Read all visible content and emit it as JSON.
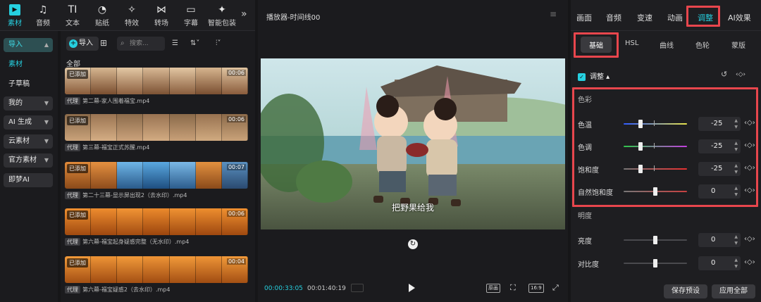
{
  "toolbar": {
    "items": [
      {
        "label": "素材",
        "icon": "media-icon",
        "active": true
      },
      {
        "label": "音频",
        "icon": "audio-icon"
      },
      {
        "label": "文本",
        "icon": "text-icon"
      },
      {
        "label": "贴纸",
        "icon": "sticker-icon"
      },
      {
        "label": "特效",
        "icon": "effects-icon"
      },
      {
        "label": "转场",
        "icon": "transition-icon"
      },
      {
        "label": "字幕",
        "icon": "subtitle-icon"
      },
      {
        "label": "智能包装",
        "icon": "smart-pack-icon"
      }
    ],
    "more": "»"
  },
  "sidenav": {
    "items": [
      {
        "label": "导入"
      },
      {
        "label": "素材"
      },
      {
        "label": "子草稿"
      },
      {
        "label": "我的"
      },
      {
        "label": "AI 生成"
      },
      {
        "label": "云素材"
      },
      {
        "label": "官方素材"
      },
      {
        "label": "即梦AI"
      }
    ]
  },
  "media": {
    "import_label": "导入",
    "search_placeholder": "搜索...",
    "all_label": "全部",
    "clips": [
      {
        "badge": "已添加",
        "duration": "00:06",
        "tag": "代理",
        "name": "第二幕-家人围着福宝.mp4"
      },
      {
        "badge": "已添加",
        "duration": "00:06",
        "tag": "代理",
        "name": "第三幕-福宝正式苏醒.mp4"
      },
      {
        "badge": "已添加",
        "duration": "00:07",
        "tag": "代理",
        "name": "第二十三幕-显示屏出现2（去水印）.mp4"
      },
      {
        "badge": "已添加",
        "duration": "00:06",
        "tag": "代理",
        "name": "第六幕-福宝起身疑惑完整（无水印）.mp4"
      },
      {
        "badge": "已添加",
        "duration": "00:04",
        "tag": "代理",
        "name": "第六幕-福宝疑惑2（去水印）.mp4"
      }
    ]
  },
  "player": {
    "title": "播放器-时间线00",
    "subtitle": "把野果给我",
    "time_current": "00:00:33:05",
    "time_total": "00:01:40:19",
    "btn_original": "原画",
    "btn_ratio": "16:9"
  },
  "right": {
    "tabs": [
      "画面",
      "音频",
      "变速",
      "动画",
      "调整",
      "AI效果"
    ],
    "active_tab": "调整",
    "subtabs": [
      "基础",
      "HSL",
      "曲线",
      "色轮",
      "蒙版"
    ],
    "active_subtab": "基础",
    "section_label": "调整",
    "group_color": "色彩",
    "group_light": "明度",
    "color_rows": [
      {
        "label": "色温",
        "value": "-25",
        "knob_pct": 0.27,
        "gradient": "linear-gradient(90deg,#2f5bff,#e8e34a)"
      },
      {
        "label": "色调",
        "value": "-25",
        "knob_pct": 0.27,
        "gradient": "linear-gradient(90deg,#2fc64a,#c43ee0)"
      },
      {
        "label": "饱和度",
        "value": "-25",
        "knob_pct": 0.27,
        "gradient": "linear-gradient(90deg,#777,#e83030)"
      },
      {
        "label": "自然饱和度",
        "value": "0",
        "knob_pct": 0.5,
        "gradient": "linear-gradient(90deg,#777,#c84040)"
      }
    ],
    "light_rows": [
      {
        "label": "亮度",
        "value": "0",
        "knob_pct": 0.5,
        "gradient": "linear-gradient(90deg,#444,#555)"
      },
      {
        "label": "对比度",
        "value": "0",
        "knob_pct": 0.5,
        "gradient": "linear-gradient(90deg,#444,#555)"
      }
    ],
    "save_preset": "保存预设",
    "apply_all": "应用全部"
  },
  "colors": {
    "accent": "#26d0e0",
    "highlight": "#e8464d"
  }
}
